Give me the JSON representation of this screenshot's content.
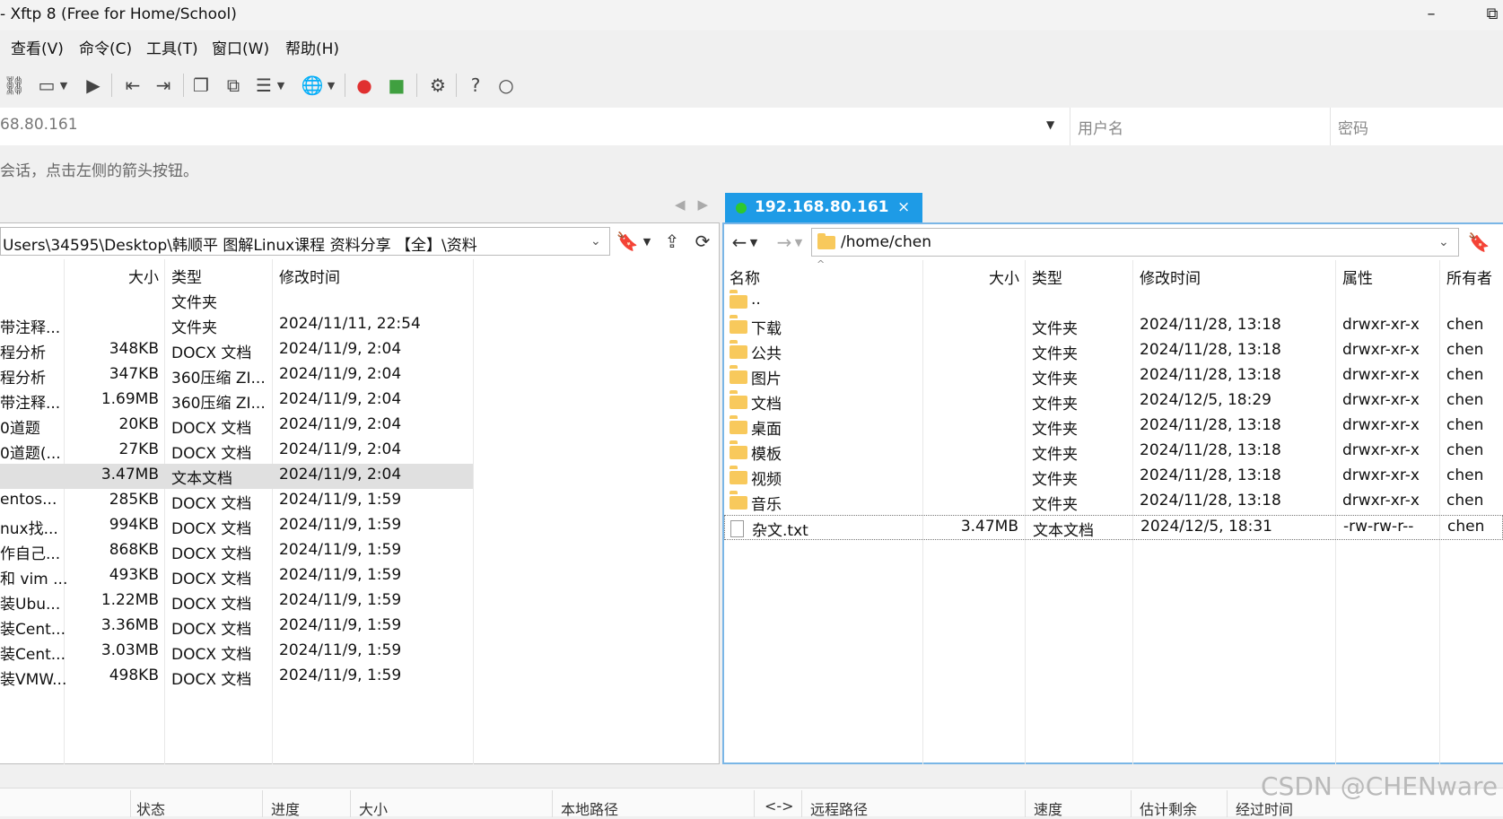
{
  "window": {
    "title": "- Xftp 8 (Free for Home/School)",
    "minimize_icon": "–",
    "restore_icon": "⧉"
  },
  "menu": [
    "查看(V)",
    "命令(C)",
    "工具(T)",
    "窗口(W)",
    "帮助(H)"
  ],
  "toolbar": {
    "icons": [
      "link-icon",
      "new-session-icon",
      "dropdown-icon",
      "play-icon",
      "left-transfer-icon",
      "right-transfer-icon",
      "copy-icon",
      "copy-multi-icon",
      "list-view-icon",
      "dropdown-icon",
      "globe-icon",
      "dropdown-icon",
      "xshell-icon",
      "xftp-icon",
      "gear-icon",
      "help-icon",
      "chat-icon"
    ]
  },
  "address": {
    "host": "68.80.161",
    "username_placeholder": "用户名",
    "password_placeholder": "密码"
  },
  "hint": "会话，点击左侧的箭头按钮。",
  "remote_tab": {
    "label": "192.168.80.161",
    "close": "×",
    "status_color": "#2ec82e"
  },
  "left": {
    "path": "Users\\34595\\Desktop\\韩顺平 图解Linux课程 资料分享 【全】\\资料",
    "headers": {
      "size": "大小",
      "type": "类型",
      "modified": "修改时间"
    },
    "rows": [
      {
        "name": "",
        "size": "",
        "type": "文件夹",
        "modified": ""
      },
      {
        "name": "带注释...",
        "size": "",
        "type": "文件夹",
        "modified": "2024/11/11, 22:54"
      },
      {
        "name": "程分析",
        "size": "348KB",
        "type": "DOCX 文档",
        "modified": "2024/11/9, 2:04"
      },
      {
        "name": "程分析",
        "size": "347KB",
        "type": "360压缩 ZI...",
        "modified": "2024/11/9, 2:04"
      },
      {
        "name": "带注释...",
        "size": "1.69MB",
        "type": "360压缩 ZI...",
        "modified": "2024/11/9, 2:04"
      },
      {
        "name": "0道题",
        "size": "20KB",
        "type": "DOCX 文档",
        "modified": "2024/11/9, 2:04"
      },
      {
        "name": "0道题(...",
        "size": "27KB",
        "type": "DOCX 文档",
        "modified": "2024/11/9, 2:04"
      },
      {
        "name": "",
        "size": "3.47MB",
        "type": "文本文档",
        "modified": "2024/11/9, 2:04"
      },
      {
        "name": "entos...",
        "size": "285KB",
        "type": "DOCX 文档",
        "modified": "2024/11/9, 1:59"
      },
      {
        "name": "nux找...",
        "size": "994KB",
        "type": "DOCX 文档",
        "modified": "2024/11/9, 1:59"
      },
      {
        "name": "作自己...",
        "size": "868KB",
        "type": "DOCX 文档",
        "modified": "2024/11/9, 1:59"
      },
      {
        "name": "和 vim ...",
        "size": "493KB",
        "type": "DOCX 文档",
        "modified": "2024/11/9, 1:59"
      },
      {
        "name": "装Ubu...",
        "size": "1.22MB",
        "type": "DOCX 文档",
        "modified": "2024/11/9, 1:59"
      },
      {
        "name": "装Cent...",
        "size": "3.36MB",
        "type": "DOCX 文档",
        "modified": "2024/11/9, 1:59"
      },
      {
        "name": "装Cent...",
        "size": "3.03MB",
        "type": "DOCX 文档",
        "modified": "2024/11/9, 1:59"
      },
      {
        "name": "装VMW...",
        "size": "498KB",
        "type": "DOCX 文档",
        "modified": "2024/11/9, 1:59"
      }
    ]
  },
  "right": {
    "path": "/home/chen",
    "headers": {
      "name": "名称",
      "size": "大小",
      "type": "类型",
      "modified": "修改时间",
      "attr": "属性",
      "owner": "所有者"
    },
    "rows": [
      {
        "name": "..",
        "size": "",
        "type": "",
        "modified": "",
        "attr": "",
        "owner": ""
      },
      {
        "name": "下载",
        "size": "",
        "type": "文件夹",
        "modified": "2024/11/28, 13:18",
        "attr": "drwxr-xr-x",
        "owner": "chen"
      },
      {
        "name": "公共",
        "size": "",
        "type": "文件夹",
        "modified": "2024/11/28, 13:18",
        "attr": "drwxr-xr-x",
        "owner": "chen"
      },
      {
        "name": "图片",
        "size": "",
        "type": "文件夹",
        "modified": "2024/11/28, 13:18",
        "attr": "drwxr-xr-x",
        "owner": "chen"
      },
      {
        "name": "文档",
        "size": "",
        "type": "文件夹",
        "modified": "2024/12/5, 18:29",
        "attr": "drwxr-xr-x",
        "owner": "chen"
      },
      {
        "name": "桌面",
        "size": "",
        "type": "文件夹",
        "modified": "2024/11/28, 13:18",
        "attr": "drwxr-xr-x",
        "owner": "chen"
      },
      {
        "name": "模板",
        "size": "",
        "type": "文件夹",
        "modified": "2024/11/28, 13:18",
        "attr": "drwxr-xr-x",
        "owner": "chen"
      },
      {
        "name": "视频",
        "size": "",
        "type": "文件夹",
        "modified": "2024/11/28, 13:18",
        "attr": "drwxr-xr-x",
        "owner": "chen"
      },
      {
        "name": "音乐",
        "size": "",
        "type": "文件夹",
        "modified": "2024/11/28, 13:18",
        "attr": "drwxr-xr-x",
        "owner": "chen"
      },
      {
        "name": "杂文.txt",
        "size": "3.47MB",
        "type": "文本文档",
        "modified": "2024/12/5, 18:31",
        "attr": "-rw-rw-r--",
        "owner": "chen"
      }
    ]
  },
  "transfer_columns": [
    "状态",
    "进度",
    "大小",
    "本地路径",
    "<->",
    "远程路径",
    "速度",
    "估计剩余",
    "经过时间"
  ],
  "watermark": "CSDN @CHENware"
}
